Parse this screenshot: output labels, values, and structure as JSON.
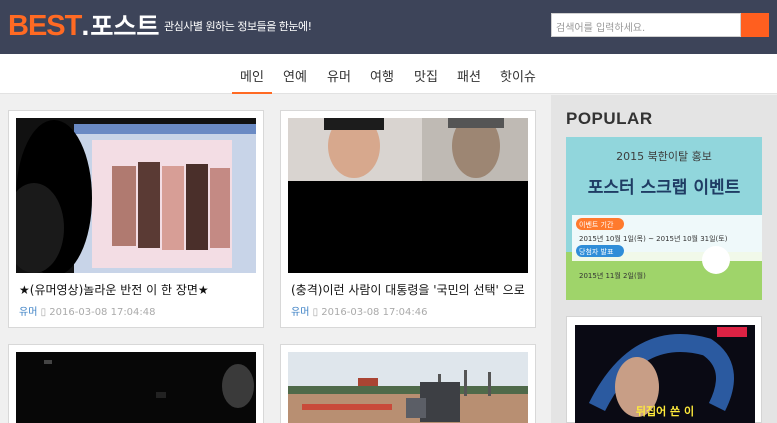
{
  "header": {
    "logo_best": "BEST",
    "logo_dot": ".",
    "logo_post": "포스트",
    "tagline": "관심사별 원하는 정보들을 한눈에!",
    "search_placeholder": "검색어를 입력하세요."
  },
  "nav": {
    "items": [
      {
        "label": "메인",
        "active": true
      },
      {
        "label": "연예",
        "active": false
      },
      {
        "label": "유머",
        "active": false
      },
      {
        "label": "여행",
        "active": false
      },
      {
        "label": "맛집",
        "active": false
      },
      {
        "label": "패션",
        "active": false
      },
      {
        "label": "핫이슈",
        "active": false
      }
    ]
  },
  "cards": [
    {
      "title": "★(유머영상)놀라운 반전 이 한 장면★",
      "category": "유머",
      "date": "2016-03-08 17:04:48"
    },
    {
      "title": "(충격)이런 사람이 대통령을 '국민의 선택' 으로 한 사람 분석해보니 안",
      "category": "유머",
      "date": "2016-03-08 17:04:46"
    },
    {
      "title": "",
      "category": "",
      "date": ""
    },
    {
      "title": "",
      "category": "",
      "date": ""
    }
  ],
  "sidebar": {
    "popular_title": "POPULAR",
    "banner": {
      "line1": "2015 북한이탈 홍보",
      "line2": "포스터 스크랩 이벤트",
      "period_label": "이벤트 기간",
      "period_value": "2015년 10월 1일(목) ~ 2015년 10월 31일(토)",
      "winner_label": "당첨자 발표",
      "winner_value": "2015년 11월 2일(월)"
    },
    "banner2_caption": "뒤집어 쓴 이"
  },
  "colors": {
    "header_bg": "#3d4459",
    "accent": "#ff6a23",
    "category_link": "#3a7fc4"
  }
}
